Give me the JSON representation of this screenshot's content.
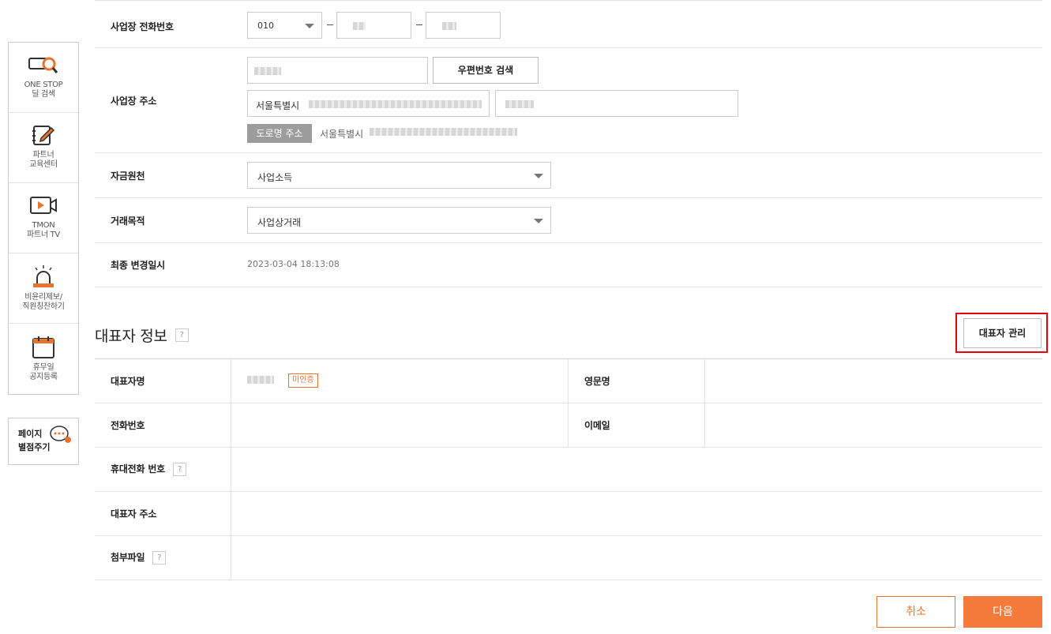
{
  "quick_menu": {
    "items": [
      {
        "label": "ONE STOP\n딜 검색",
        "icon": "deal-search-icon"
      },
      {
        "label": "파트너\n교육센터",
        "icon": "edit-note-icon"
      },
      {
        "label": "TMON\n파트너 TV",
        "icon": "video-play-icon"
      },
      {
        "label": "비윤리제보/\n직원칭찬하기",
        "icon": "alarm-siren-icon"
      },
      {
        "label": "휴무일\n공지등록",
        "icon": "calendar-icon"
      }
    ],
    "rate": {
      "label": "페이지\n별점주기",
      "icon": "chat-bubble-icon"
    }
  },
  "business": {
    "phone_label": "사업장 전화번호",
    "phone_prefix": "010",
    "address_label": "사업장 주소",
    "zip_search_button": "우편번호 검색",
    "address_city": "서울특별시",
    "road_tag": "도로명 주소",
    "road_city": "서울특별시",
    "fund_label": "자금원천",
    "fund_value": "사업소득",
    "purpose_label": "거래목적",
    "purpose_value": "사업상거래",
    "updated_label": "최종 변경일시",
    "updated_value": "2023-03-04 18:13:08"
  },
  "representative": {
    "title": "대표자 정보",
    "help": "?",
    "manage_button": "대표자 관리",
    "name_label": "대표자명",
    "verify_badge": "미인증",
    "english_name_label": "영문명",
    "phone_label": "전화번호",
    "email_label": "이메일",
    "mobile_label": "휴대전화 번호",
    "address_label": "대표자 주소",
    "attachment_label": "첨부파일"
  },
  "footer": {
    "cancel_button": "취소",
    "next_button": "다음"
  },
  "colors": {
    "accent": "#f57b3d",
    "highlight": "#e60012"
  }
}
